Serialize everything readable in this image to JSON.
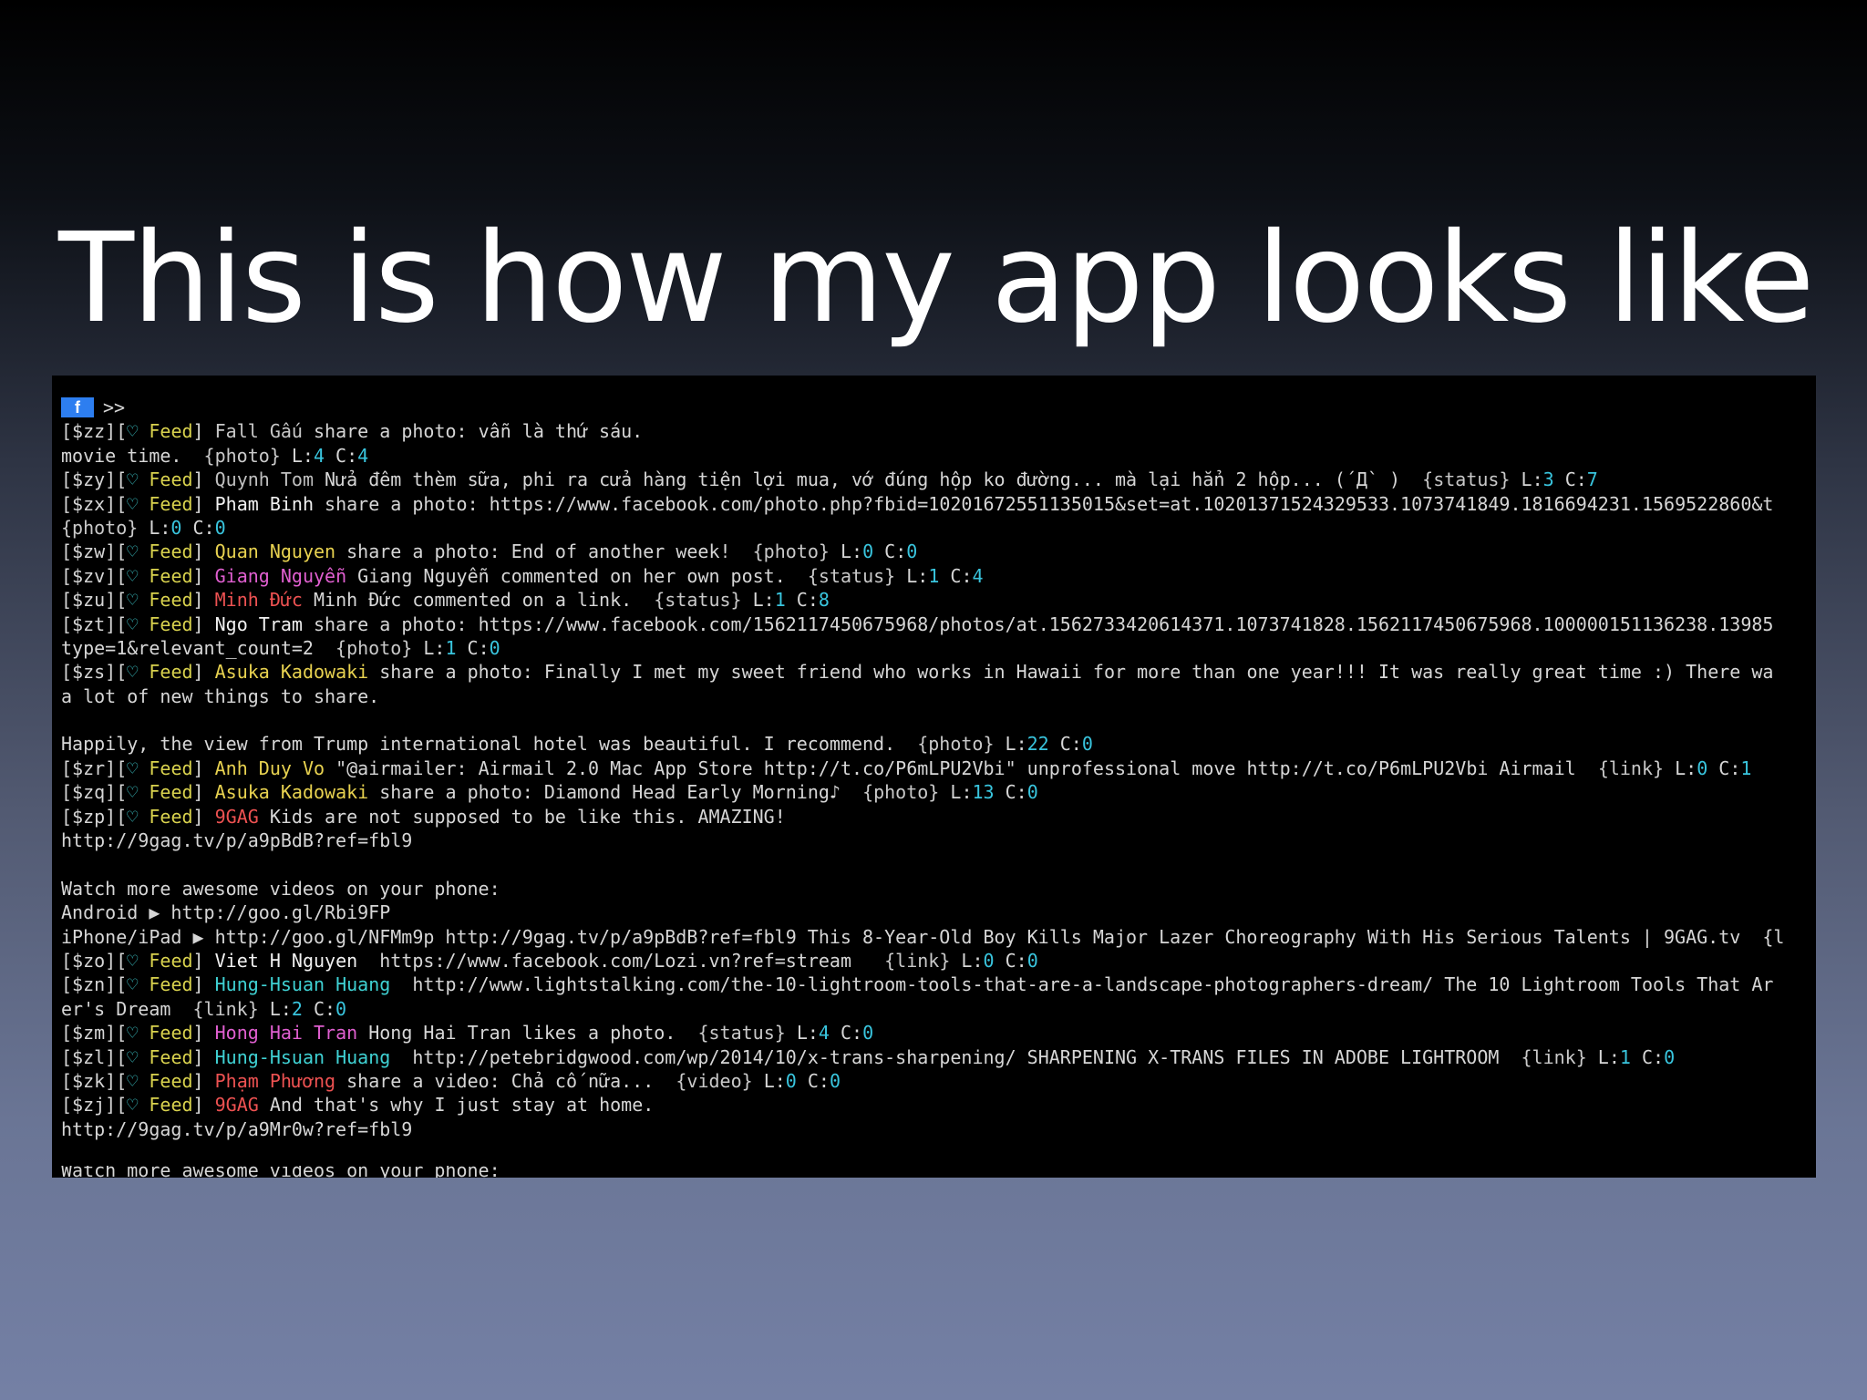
{
  "slide": {
    "title": "This is how my app looks like"
  },
  "colors": {
    "feed": "#d9d24e",
    "heart": "#3fd1d3",
    "count": "#39c5de",
    "name_default": "#f1f1f1",
    "name_yellow": "#e8d250",
    "name_magenta": "#e05fd0",
    "name_red": "#ee5252",
    "name_teal": "#3fd1d3",
    "name_gray": "#c0c0c0",
    "fb_badge": "#2d7ef0"
  },
  "terminal": {
    "badge": "f",
    "prompt": ">>",
    "feed_tag": "Feed",
    "heart_icon": "♡",
    "lines": [
      {
        "kind": "post",
        "id": "[$zz]",
        "name": "Fall Gấu",
        "name_color": "#c8c8c8",
        "text": " share a photo: vẫn là thứ sáu."
      },
      {
        "kind": "plain",
        "text": "movie time.  ",
        "type": "{photo}",
        "l": "4",
        "c": "4"
      },
      {
        "kind": "post",
        "id": "[$zy]",
        "name": "Quynh Tom",
        "name_color": "#c0c0c0",
        "text": " Nửa đêm thèm sữa, phi ra cửa hàng tiện lợi mua, vớ đúng hộp ko đường... mà lại hẳn 2 hộp... (´Д` )  ",
        "type": "{status}",
        "l": "3",
        "c": "7"
      },
      {
        "kind": "post",
        "id": "[$zx]",
        "name": "Pham Binh",
        "name_color": "#f1f1f1",
        "text": " share a photo: https://www.facebook.com/photo.php?fbid=10201672551135015&set=at.10201371524329533.1073741849.1816694231.1569522860&t"
      },
      {
        "kind": "plain",
        "text": "",
        "type": "{photo}",
        "l": "0",
        "c": "0"
      },
      {
        "kind": "post",
        "id": "[$zw]",
        "name": "Quan Nguyen",
        "name_color": "#e8d250",
        "text": " share a photo: End of another week!  ",
        "type": "{photo}",
        "l": "0",
        "c": "0"
      },
      {
        "kind": "post",
        "id": "[$zv]",
        "name": "Giang Nguyễn",
        "name_color": "#e05fd0",
        "text": " Giang Nguyễn commented on her own post.  ",
        "type": "{status}",
        "l": "1",
        "c": "4"
      },
      {
        "kind": "post",
        "id": "[$zu]",
        "name": "Minh Đức",
        "name_color": "#ee5252",
        "text": " Minh Đức commented on a link.  ",
        "type": "{status}",
        "l": "1",
        "c": "8"
      },
      {
        "kind": "post",
        "id": "[$zt]",
        "name": "Ngo Tram",
        "name_color": "#f1f1f1",
        "text": " share a photo: https://www.facebook.com/1562117450675968/photos/at.1562733420614371.1073741828.1562117450675968.100000151136238.13985"
      },
      {
        "kind": "plain",
        "text": "type=1&relevant_count=2  ",
        "type": "{photo}",
        "l": "1",
        "c": "0"
      },
      {
        "kind": "post",
        "id": "[$zs]",
        "name": "Asuka Kadowaki",
        "name_color": "#e8d250",
        "text": " share a photo: Finally I met my sweet friend who works in Hawaii for more than one year!!! It was really great time :) There wa"
      },
      {
        "kind": "plain",
        "text": "a lot of new things to share."
      },
      {
        "kind": "plain",
        "text": ""
      },
      {
        "kind": "plain",
        "text": "Happily, the view from Trump international hotel was beautiful. I recommend.  ",
        "type": "{photo}",
        "l": "22",
        "c": "0"
      },
      {
        "kind": "post",
        "id": "[$zr]",
        "name": "Anh Duy Vo",
        "name_color": "#e8d250",
        "text": " \"@airmailer: Airmail 2.0 Mac App Store http://t.co/P6mLPU2Vbi\" unprofessional move http://t.co/P6mLPU2Vbi Airmail  ",
        "type": "{link}",
        "l": "0",
        "c": "1"
      },
      {
        "kind": "post",
        "id": "[$zq]",
        "name": "Asuka Kadowaki",
        "name_color": "#e8d250",
        "text": " share a photo: Diamond Head Early Morning♪  ",
        "type": "{photo}",
        "l": "13",
        "c": "0"
      },
      {
        "kind": "post",
        "id": "[$zp]",
        "name": "9GAG",
        "name_color": "#ee5252",
        "text": " Kids are not supposed to be like this. AMAZING!"
      },
      {
        "kind": "plain",
        "text": "http://9gag.tv/p/a9pBdB?ref=fbl9"
      },
      {
        "kind": "plain",
        "text": ""
      },
      {
        "kind": "plain",
        "text": "Watch more awesome videos on your phone:"
      },
      {
        "kind": "plain",
        "text": "Android ▶ http://goo.gl/Rbi9FP"
      },
      {
        "kind": "plain",
        "text": "iPhone/iPad ▶ http://goo.gl/NFMm9p http://9gag.tv/p/a9pBdB?ref=fbl9 This 8-Year-Old Boy Kills Major Lazer Choreography With His Serious Talents | 9GAG.tv  {l"
      },
      {
        "kind": "post",
        "id": "[$zo]",
        "name": "Viet H Nguyen",
        "name_color": "#f1f1f1",
        "text": "  https://www.facebook.com/Lozi.vn?ref=stream   ",
        "type": "{link}",
        "l": "0",
        "c": "0"
      },
      {
        "kind": "post",
        "id": "[$zn]",
        "name": "Hung-Hsuan Huang",
        "name_color": "#3fd1d3",
        "text": "  http://www.lightstalking.com/the-10-lightroom-tools-that-are-a-landscape-photographers-dream/ The 10 Lightroom Tools That Ar"
      },
      {
        "kind": "plain",
        "text": "er's Dream  ",
        "type": "{link}",
        "l": "2",
        "c": "0"
      },
      {
        "kind": "post",
        "id": "[$zm]",
        "name": "Hong Hai Tran",
        "name_color": "#e05fd0",
        "text": " Hong Hai Tran likes a photo.  ",
        "type": "{status}",
        "l": "4",
        "c": "0"
      },
      {
        "kind": "post",
        "id": "[$zl]",
        "name": "Hung-Hsuan Huang",
        "name_color": "#3fd1d3",
        "text": "  http://petebridgwood.com/wp/2014/10/x-trans-sharpening/ SHARPENING X-TRANS FILES IN ADOBE LIGHTROOM  ",
        "type": "{link}",
        "l": "1",
        "c": "0"
      },
      {
        "kind": "post",
        "id": "[$zk]",
        "name": "Phạm Phương",
        "name_color": "#ee5252",
        "text": " share a video: Chả cố nữa...  ",
        "type": "{video}",
        "l": "0",
        "c": "0"
      },
      {
        "kind": "post",
        "id": "[$zj]",
        "name": "9GAG",
        "name_color": "#ee5252",
        "text": " And that's why I just stay at home."
      },
      {
        "kind": "plain",
        "text": "http://9gag.tv/p/a9Mr0w?ref=fbl9"
      },
      {
        "kind": "plain",
        "text": ""
      },
      {
        "kind": "cut",
        "text": "Watch more awesome videos on your phone:"
      }
    ]
  }
}
